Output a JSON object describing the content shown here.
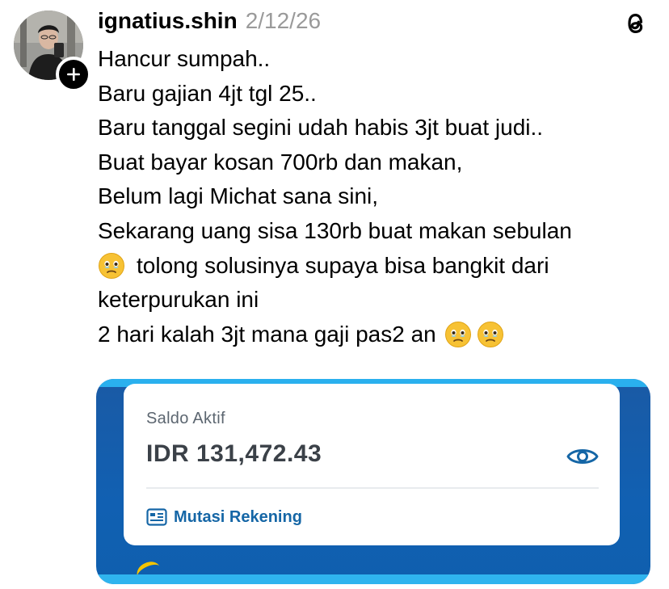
{
  "post": {
    "username": "ignatius.shin",
    "date": "2/12/26",
    "lines": [
      "Hancur sumpah..",
      "Baru gajian 4jt tgl 25..",
      "Baru tanggal segini udah habis 3jt buat judi..",
      "Buat bayar kosan 700rb dan makan,",
      "Belum lagi Michat sana sini,",
      "Sekarang uang sisa 130rb buat makan sebulan",
      "tolong solusinya supaya bisa bangkit dari",
      "keterpurukan ini",
      "2 hari kalah 3jt mana gaji pas2 an"
    ],
    "emoji_name": "face-holding-back-tears"
  },
  "icons": {
    "app": "threads-icon",
    "follow": "plus-icon"
  },
  "screenshot_card": {
    "label": "Saldo Aktif",
    "amount": "IDR 131,472.43",
    "link_label": "Mutasi Rekening",
    "eye": "eye-icon",
    "statement_icon": "statement-icon"
  },
  "colors": {
    "date": "#9a9a9a",
    "bank_blue": "#1566a6",
    "bank_bg": "#1160b2",
    "accent_cyan": "#2ab0ee"
  }
}
